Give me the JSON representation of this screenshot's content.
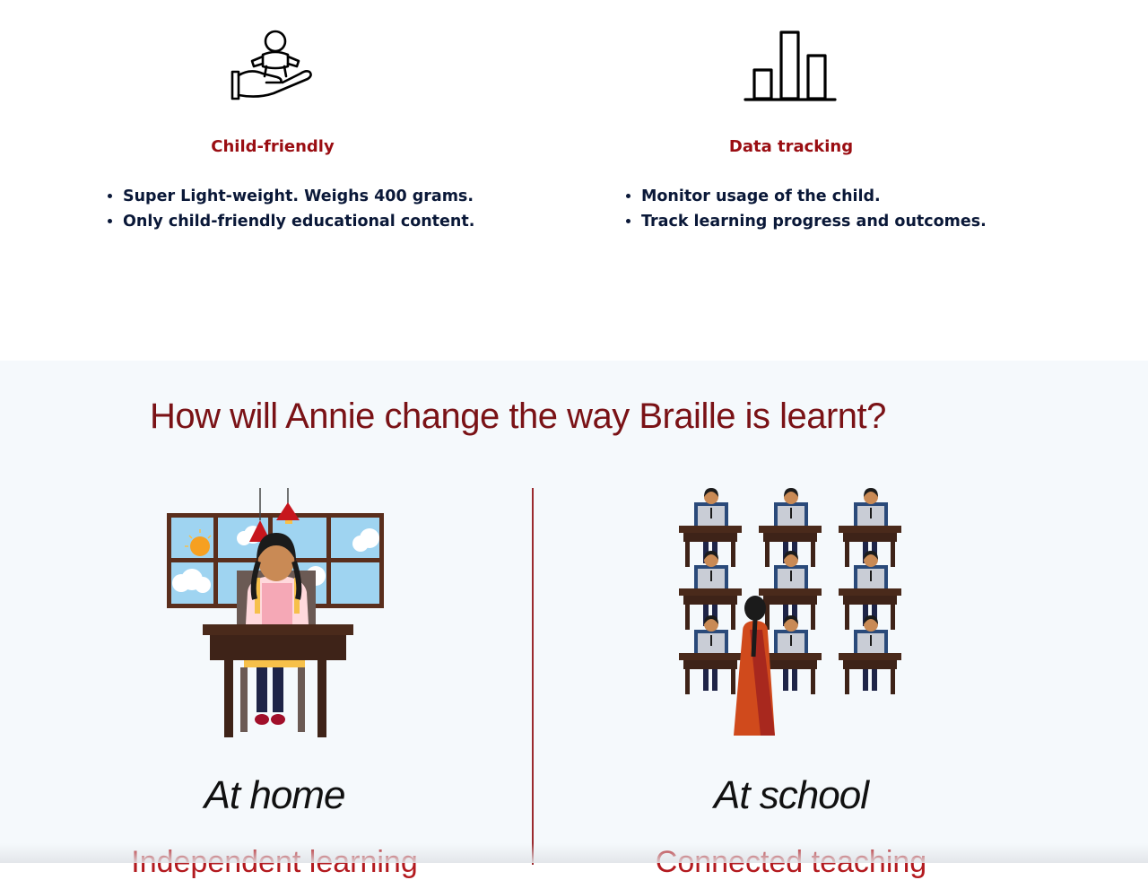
{
  "features": [
    {
      "title": "Child-friendly",
      "icon": "child-in-hand-icon",
      "bullets": [
        "Super Light-weight. Weighs 400 grams.",
        "Only child-friendly educational content."
      ]
    },
    {
      "title": "Data tracking",
      "icon": "bar-chart-icon",
      "bullets": [
        "Monitor usage of the child.",
        "Track learning progress and outcomes."
      ]
    }
  ],
  "section": {
    "heading": "How will Annie change the way Braille is learnt?",
    "cases": [
      {
        "title": "At home",
        "subtitle": "Independent learning",
        "image": "girl-at-desk-illustration"
      },
      {
        "title": "At school",
        "subtitle": "Connected teaching",
        "image": "classroom-illustration"
      }
    ]
  },
  "colors": {
    "accent": "#9a0d12",
    "heading": "#7a1216",
    "text": "#0a1838",
    "section_bg": "#f5f9fc"
  }
}
